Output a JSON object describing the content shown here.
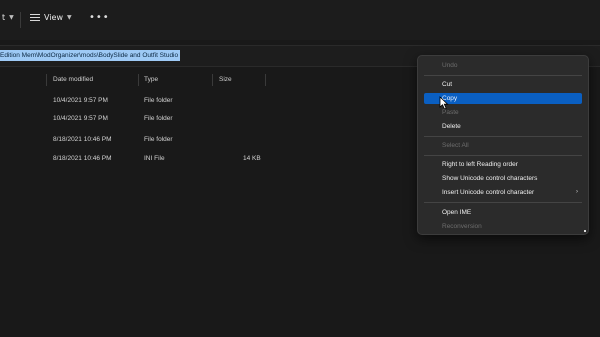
{
  "toolbar": {
    "first_label": "t",
    "view_label": "View",
    "more_label": "•••"
  },
  "address": {
    "path": "Edition Mem\\ModOrganizer\\mods\\BodySlide and Outfit Studio"
  },
  "columns": [
    "Date modified",
    "Type",
    "Size"
  ],
  "files": [
    {
      "date": "10/4/2021 9:57 PM",
      "type": "File folder",
      "size": ""
    },
    {
      "date": "10/4/2021 9:57 PM",
      "type": "File folder",
      "size": ""
    },
    {
      "date": "8/18/2021 10:46 PM",
      "type": "File folder",
      "size": ""
    },
    {
      "date": "8/18/2021 10:46 PM",
      "type": "INI File",
      "size": "14 KB"
    }
  ],
  "context_menu": {
    "undo": "Undo",
    "cut": "Cut",
    "copy": "Copy",
    "paste": "Paste",
    "delete": "Delete",
    "select_all": "Select All",
    "rtl": "Right to left Reading order",
    "show_unicode": "Show Unicode control characters",
    "insert_unicode": "Insert Unicode control character",
    "open_ime": "Open IME",
    "reconversion": "Reconversion"
  },
  "colors": {
    "highlight": "#0a5fc2",
    "path_selection": "#9ecaf5",
    "background": "#191919"
  }
}
